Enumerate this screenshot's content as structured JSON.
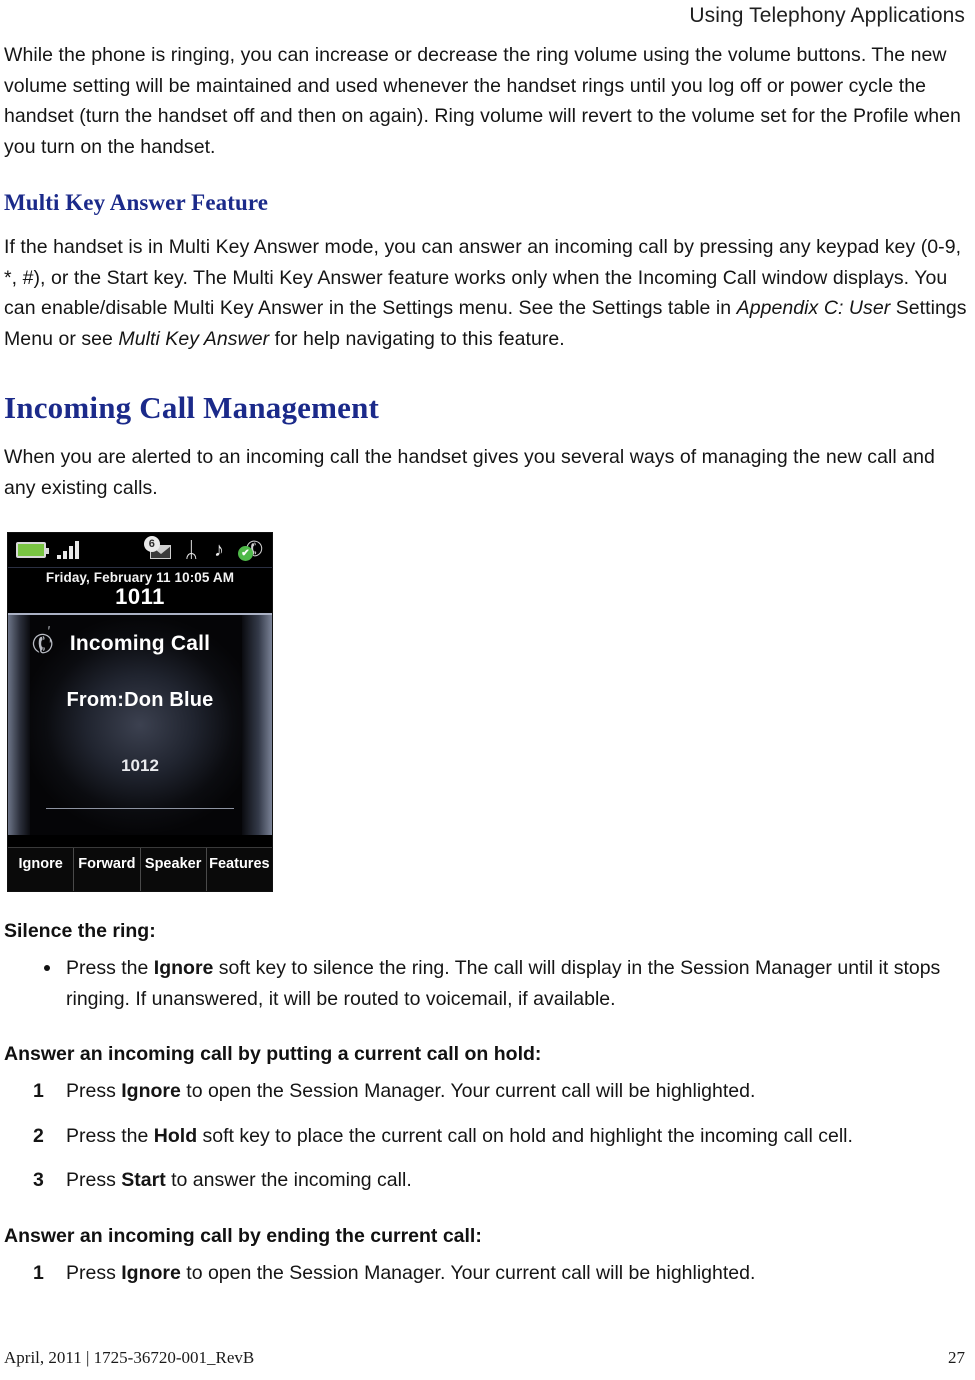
{
  "header": {
    "running_title": "Using Telephony Applications"
  },
  "intro": {
    "paragraph": "While the phone is ringing, you can increase or decrease the ring volume using the volume buttons. The new volume setting will be maintained and used whenever the handset rings until you log off or power cycle the handset (turn the handset off and then on again). Ring volume will revert to the volume set for the Profile when you turn on the handset."
  },
  "multi_key": {
    "heading": "Multi Key Answer Feature",
    "para_part1": "If the handset is in Multi Key Answer mode, you can answer an incoming call by pressing any keypad key (0-9, *, #), or the Start key. The Multi Key Answer feature works only when the Incoming Call window displays. You can enable/disable Multi Key Answer in the Settings menu. See the Settings table in ",
    "italic_ref1": "Appendix C: User",
    "para_part2": " Settings Menu or see ",
    "italic_ref2": "Multi Key Answer",
    "para_part3": " for help navigating to this feature."
  },
  "incoming_call": {
    "heading": "Incoming Call Management",
    "paragraph": "When you are alerted to an incoming call the handset gives you several ways of managing the new call and any existing calls."
  },
  "phone_screen": {
    "status": {
      "battery_icon": "battery-icon",
      "signal_icon": "signal-bars-icon",
      "voicemail_icon": "voicemail-envelope-icon",
      "voicemail_badge": "6",
      "bluetooth_icon": "bluetooth-icon",
      "bluetooth_glyph": "ᛦ",
      "music_icon": "music-note-icon",
      "music_glyph": "♪",
      "handset_icon": "handset-active-icon",
      "handset_glyph": "✆",
      "check_glyph": "✔"
    },
    "date_time": "Friday, February 11 10:05 AM",
    "extension": "1011",
    "ring_icon": "ringing-handset-icon",
    "ring_glyph": "✆",
    "ring_waves": "\"",
    "call_title": "Incoming Call",
    "call_from": "From:Don Blue",
    "caller_number": "1012",
    "softkeys": [
      {
        "label": "Ignore"
      },
      {
        "label": "Forward"
      },
      {
        "label": "Speaker"
      },
      {
        "label": "Features"
      }
    ]
  },
  "silence": {
    "heading": "Silence the ring:",
    "bullet_pre": "Press the ",
    "bullet_bold": "Ignore",
    "bullet_post": " soft key to silence the ring. The call will display in the Session Manager until it stops ringing. If unanswered, it will be routed to voicemail, if available."
  },
  "hold_section": {
    "heading": "Answer an incoming call by putting a current call on hold:",
    "steps": [
      {
        "num": "1",
        "pre": "Press ",
        "bold": "Ignore",
        "post": " to open the Session Manager. Your current call will be highlighted."
      },
      {
        "num": "2",
        "pre": "Press the ",
        "bold": "Hold",
        "post": " soft key to place the current call on hold and highlight the incoming call cell."
      },
      {
        "num": "3",
        "pre": "Press ",
        "bold": "Start",
        "post": " to answer the incoming call."
      }
    ]
  },
  "end_section": {
    "heading": "Answer an incoming call by ending the current call:",
    "steps": [
      {
        "num": "1",
        "pre": "Press ",
        "bold": "Ignore",
        "post": " to open the Session Manager. Your current call will be highlighted."
      }
    ]
  },
  "footer": {
    "left": "April, 2011  |  1725-36720-001_RevB",
    "page_number": "27"
  },
  "colors": {
    "heading_blue": "#1b2a8a",
    "battery_green": "#79c442",
    "status_green": "#4fb949"
  }
}
